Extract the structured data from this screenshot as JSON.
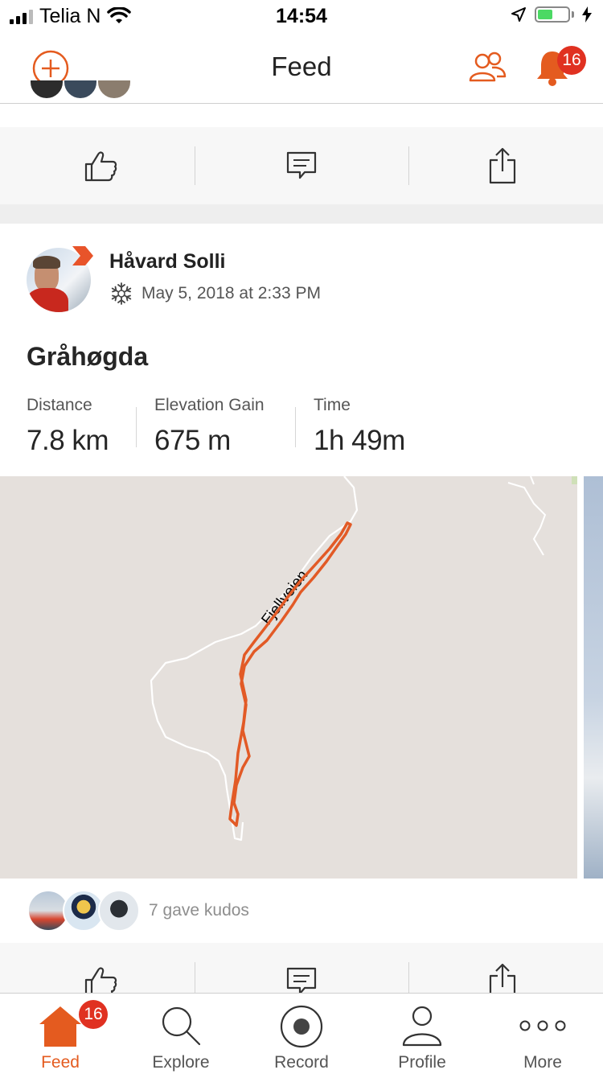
{
  "status_bar": {
    "carrier": "Telia N",
    "time": "14:54",
    "battery_level": 0.5
  },
  "header": {
    "title": "Feed",
    "notification_count": "16",
    "icons": [
      "add-activity-icon",
      "athletes-icon",
      "bell-icon"
    ]
  },
  "previous_post": {
    "actions": [
      "kudos",
      "comment",
      "share"
    ]
  },
  "post": {
    "athlete_name": "Håvard Solli",
    "sport_icon": "snowflake-icon",
    "datetime": "May 5, 2018 at 2:33 PM",
    "title": "Gråhøgda",
    "stats": [
      {
        "label": "Distance",
        "value": "7.8 km"
      },
      {
        "label": "Elevation Gain",
        "value": "675 m"
      },
      {
        "label": "Time",
        "value": "1h 49m"
      }
    ],
    "map": {
      "road_label": "Fjellveien",
      "route_color": "#e25a26"
    },
    "kudos_text": "7 gave kudos"
  },
  "tab_bar": {
    "tabs": [
      {
        "label": "Feed",
        "icon": "home-icon",
        "active": true,
        "badge": "16"
      },
      {
        "label": "Explore",
        "icon": "search-icon"
      },
      {
        "label": "Record",
        "icon": "record-icon"
      },
      {
        "label": "Profile",
        "icon": "profile-icon"
      },
      {
        "label": "More",
        "icon": "more-icon"
      }
    ]
  },
  "colors": {
    "accent": "#e45b1f",
    "badge": "#e03121",
    "map_background": "#e5e0dc"
  }
}
